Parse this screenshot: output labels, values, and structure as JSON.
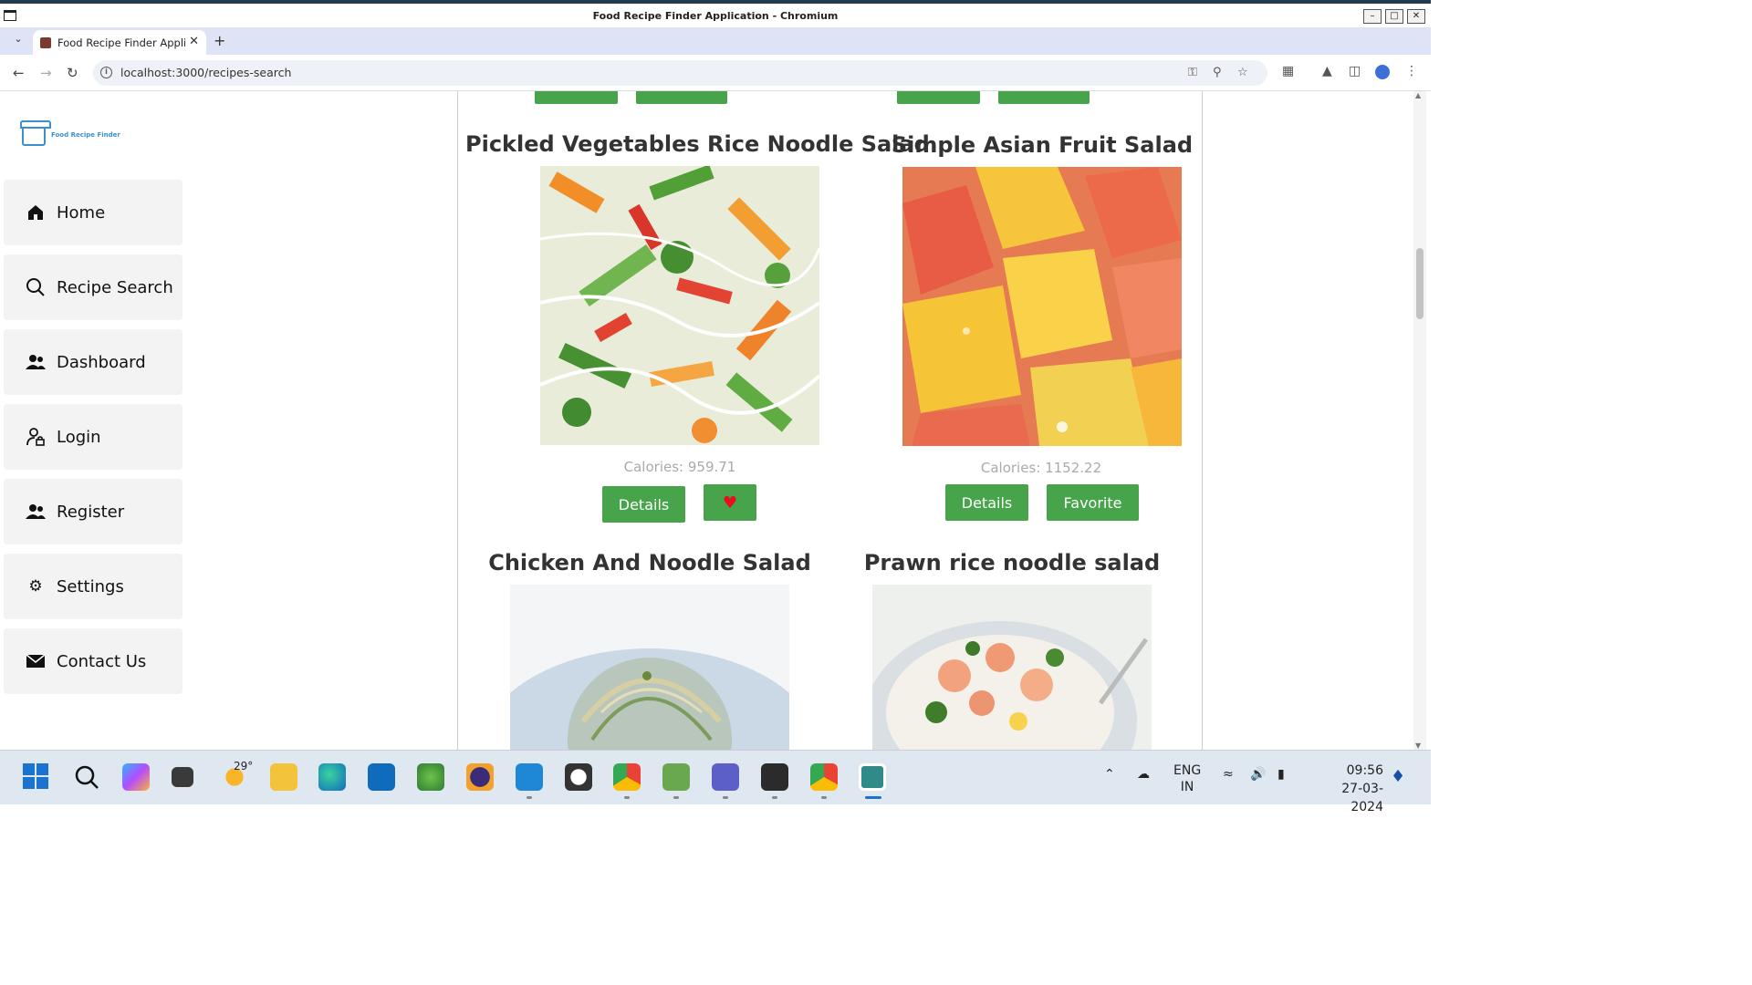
{
  "window": {
    "title": "Food Recipe Finder Application - Chromium",
    "buttons": [
      "–",
      "□",
      "✕"
    ]
  },
  "tabs": [
    {
      "title": "Food Recipe Finder Applic",
      "close": "✕"
    }
  ],
  "address_bar": {
    "url": "localhost:3000/recipes-search"
  },
  "sidebar": {
    "logo_text": "Food Recipe Finder",
    "items": [
      {
        "label": "Home",
        "icon": "home-icon"
      },
      {
        "label": "Recipe Search",
        "icon": "search-icon"
      },
      {
        "label": "Dashboard",
        "icon": "users-icon"
      },
      {
        "label": "Login",
        "icon": "user-lock-icon"
      },
      {
        "label": "Register",
        "icon": "users-icon"
      },
      {
        "label": "Settings",
        "icon": "gear-icon"
      },
      {
        "label": "Contact Us",
        "icon": "envelope-icon"
      }
    ]
  },
  "recipes": [
    {
      "title": "Pickled Vegetables Rice Noodle Salad",
      "calories": "Calories: 959.71",
      "details_label": "Details",
      "favorite_label": "♥",
      "favorited": true
    },
    {
      "title": "Simple Asian Fruit Salad",
      "calories": "Calories: 1152.22",
      "details_label": "Details",
      "favorite_label": "Favorite",
      "favorited": false
    },
    {
      "title": "Chicken And Noodle Salad"
    },
    {
      "title": "Prawn rice noodle salad"
    }
  ],
  "taskbar": {
    "weather_temp": "29°",
    "lang_line1": "ENG",
    "lang_line2": "IN",
    "time": "09:56",
    "date": "27-03-2024"
  },
  "colors": {
    "accent_green": "#47a44b",
    "heart_red": "#e5101b",
    "logo_blue": "#3b8fd1"
  }
}
